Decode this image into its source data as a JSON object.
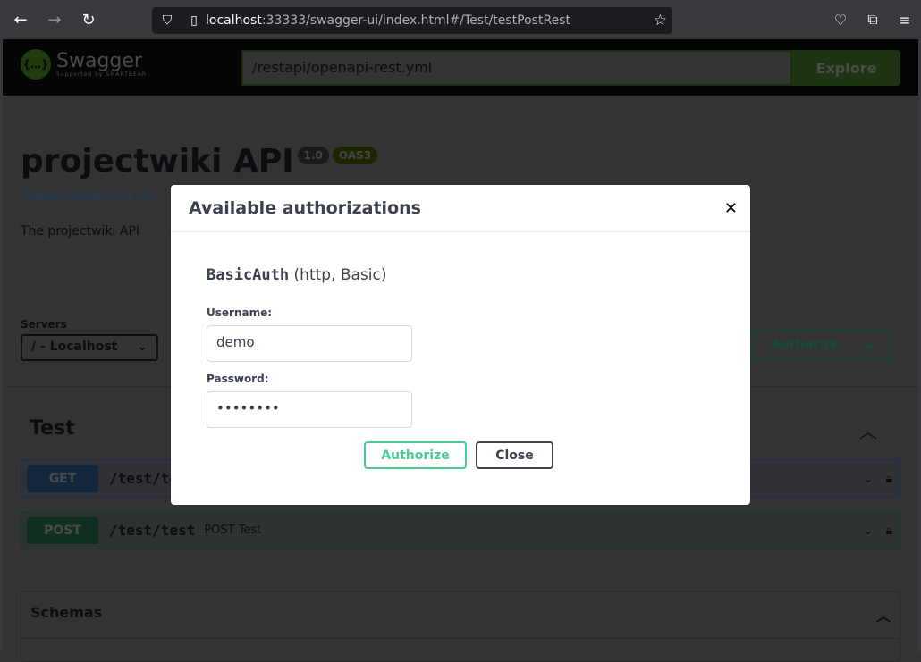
{
  "browser": {
    "url_host": "localhost",
    "url_rest": ":33333/swagger-ui/index.html#/Test/testPostRest"
  },
  "swagger": {
    "logo_name": "Swagger",
    "logo_sub": "Supported by SMARTBEAR",
    "spec_url": "/restapi/openapi-rest.yml",
    "explore_label": "Explore"
  },
  "info": {
    "title": "projectwiki API",
    "version": "1.0",
    "oas": "OAS3",
    "link": "/restapi/openapi-rest.yml",
    "description": "The projectwiki API"
  },
  "servers": {
    "label": "Servers",
    "selected": "/ - Localhost"
  },
  "authorize_label": "Authorize",
  "tag": {
    "name": "Test"
  },
  "operations": [
    {
      "method": "GET",
      "path": "/test/test",
      "summary": ""
    },
    {
      "method": "POST",
      "path": "/test/test",
      "summary": "POST Test"
    }
  ],
  "schemas_label": "Schemas",
  "modal": {
    "title": "Available authorizations",
    "scheme_name": "BasicAuth",
    "scheme_type": "(http, Basic)",
    "username_label": "Username:",
    "username_value": "demo",
    "password_label": "Password:",
    "password_value": "••••••••",
    "authorize_label": "Authorize",
    "close_label": "Close"
  },
  "colors": {
    "get": "#61affe",
    "post": "#49cc90",
    "accent": "#49cc90"
  }
}
